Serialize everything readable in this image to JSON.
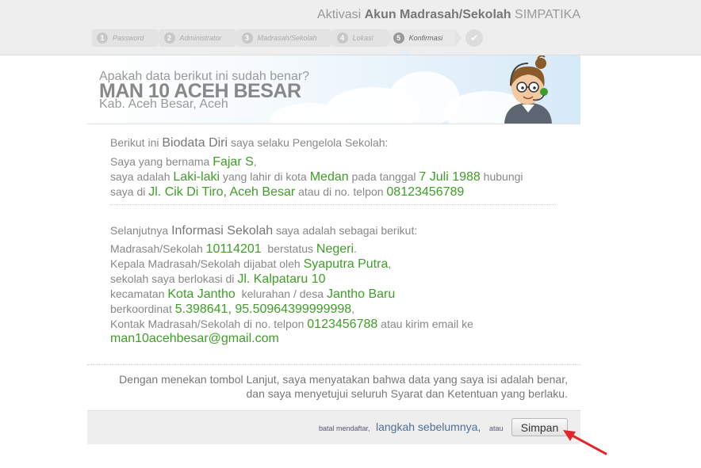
{
  "header": {
    "title_prefix": "Aktivasi",
    "title_bold": "Akun Madrasah/Sekolah",
    "title_app": "SIMPATIKA",
    "steps": [
      {
        "num": "1",
        "label": "Password"
      },
      {
        "num": "2",
        "label": "Administrator"
      },
      {
        "num": "3",
        "label": "Madrasah/Sekolah"
      },
      {
        "num": "4",
        "label": "Lokasi"
      },
      {
        "num": "5",
        "label": "Konfirmasi"
      }
    ],
    "done_icon": "check-icon"
  },
  "banner": {
    "question": "Apakah data berikut ini sudah benar?",
    "school_name": "MAN 10 ACEH BESAR",
    "region": "Kab. Aceh Besar, Aceh"
  },
  "biodata": {
    "intro_pre": "Berikut ini",
    "intro_heading": "Biodata Diri",
    "intro_post": "saya selaku Pengelola Sekolah:",
    "name_pre": "Saya yang bernama",
    "name": "Fajar S",
    "name_post": ",",
    "gender_pre": "saya adalah",
    "gender": "Laki-laki",
    "city_pre": "yang lahir di kota",
    "city": "Medan",
    "date_pre": "pada tanggal",
    "date": "7 Juli 1988",
    "date_post": "hubungi",
    "address_pre": "saya di",
    "address": "Jl. Cik Di Tiro, Aceh Besar",
    "phone_pre": "atau di no. telpon",
    "phone": "08123456789"
  },
  "school_info": {
    "intro_pre": "Selanjutnya",
    "intro_heading": "Informasi Sekolah",
    "intro_post": "saya adalah sebagai berikut:",
    "npsn_pre": "Madrasah/Sekolah",
    "npsn": "10114201",
    "status_pre": "berstatus",
    "status": "Negeri",
    "status_post": ".",
    "head_pre": "Kepala Madrasah/Sekolah dijabat oleh",
    "head": "Syaputra Putra",
    "head_post": ",",
    "location_pre": "sekolah saya berlokasi di",
    "location": "Jl. Kalpataru 10",
    "district_pre": "kecamatan",
    "district": "Kota Jantho",
    "village_pre": "kelurahan / desa",
    "village": "Jantho Baru",
    "coord_pre": "berkoordinat",
    "coord": "5.398641, 95.50964399999998",
    "coord_post": ",",
    "contact_pre": "Kontak Madrasah/Sekolah di no. telpon",
    "contact_phone": "0123456788",
    "contact_post": "atau kirim email ke",
    "email": "man10acehbesar@gmail.com"
  },
  "agreement": {
    "line1": "Dengan menekan tombol Lanjut, saya menyatakan bahwa data yang saya isi adalah benar,",
    "line2": "dan saya menyetujui seluruh Syarat dan Ketentuan yang berlaku."
  },
  "footer": {
    "cancel_text": "batal mendaftar,",
    "back_link": "langkah sebelumnya",
    "back_post": ",",
    "or_text": "atau",
    "save_label": "Simpan"
  },
  "colors": {
    "accent_green": "#3f9e27",
    "link_blue": "#4b6f96",
    "arrow_red": "#e3262b"
  }
}
